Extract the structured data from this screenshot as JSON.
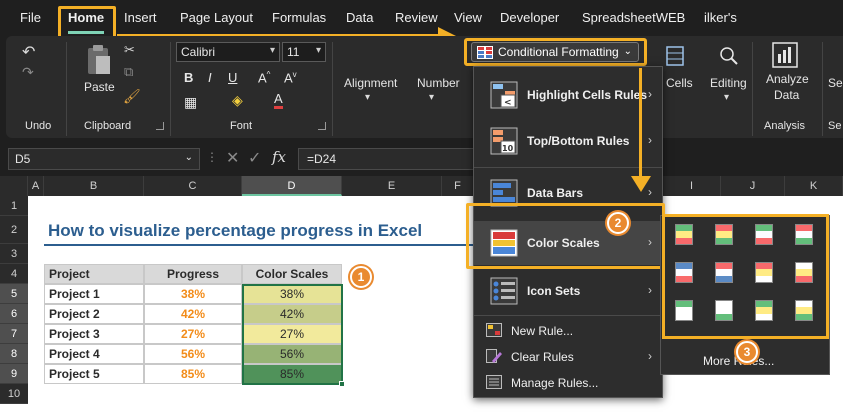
{
  "tabs": [
    "File",
    "Home",
    "Insert",
    "Page Layout",
    "Formulas",
    "Data",
    "Review",
    "View",
    "Developer",
    "SpreadsheetWEB",
    "ilker's"
  ],
  "ribbon": {
    "groups": {
      "undo": "Undo",
      "clipboard": "Clipboard",
      "font": "Font",
      "analysis": "Analysis",
      "sensitivity_partial": "Se"
    },
    "paste_label": "Paste",
    "font_name": "Calibri",
    "font_size": "11",
    "alignment_label": "Alignment",
    "number_label": "Number",
    "cells_label": "Cells",
    "editing_label": "Editing",
    "analyze_line1": "Analyze",
    "analyze_line2": "Data",
    "sens_partial": "Sen",
    "conditional_formatting": "Conditional Formatting"
  },
  "formula_bar": {
    "name_box": "D5",
    "formula": "=D24"
  },
  "columns": [
    "A",
    "B",
    "C",
    "D",
    "E",
    "F",
    "G",
    "H",
    "I",
    "J",
    "K"
  ],
  "rows": [
    "1",
    "2",
    "3",
    "4",
    "5",
    "6",
    "7",
    "8",
    "9",
    "10"
  ],
  "sheet": {
    "title": "How to visualize percentage progress in Excel",
    "headers": [
      "Project",
      "Progress",
      "Color Scales"
    ],
    "projects": [
      {
        "name": "Project 1",
        "progress": "38%",
        "scale": "38%",
        "color": "#e6e396"
      },
      {
        "name": "Project 2",
        "progress": "42%",
        "scale": "42%",
        "color": "#c6cd8a"
      },
      {
        "name": "Project 3",
        "progress": "27%",
        "scale": "27%",
        "color": "#f2ea9c"
      },
      {
        "name": "Project 4",
        "progress": "56%",
        "scale": "56%",
        "color": "#97b375"
      },
      {
        "name": "Project 5",
        "progress": "85%",
        "scale": "85%",
        "color": "#50925a"
      }
    ]
  },
  "menu": {
    "items": [
      {
        "label": "Highlight Cells Rules",
        "icon": "highlight-cells-icon",
        "submenu": true
      },
      {
        "label": "Top/Bottom Rules",
        "icon": "top-bottom-icon",
        "submenu": true
      },
      {
        "label": "Data Bars",
        "icon": "data-bars-icon",
        "submenu": true
      },
      {
        "label": "Color Scales",
        "icon": "color-scales-icon",
        "submenu": true
      },
      {
        "label": "Icon Sets",
        "icon": "icon-sets-icon",
        "submenu": true
      }
    ],
    "small_items": [
      {
        "label": "New Rule...",
        "icon": "new-rule-icon"
      },
      {
        "label": "Clear Rules",
        "icon": "clear-rules-icon",
        "submenu": true
      },
      {
        "label": "Manage Rules...",
        "icon": "manage-rules-icon"
      }
    ]
  },
  "submenu": {
    "more_rules": "More Rules...",
    "scales": [
      [
        "#63be7b",
        "#ffeb84",
        "#f8696b"
      ],
      [
        "#f8696b",
        "#ffeb84",
        "#63be7b"
      ],
      [
        "#63be7b",
        "#fcfcff",
        "#f8696b"
      ],
      [
        "#f8696b",
        "#fcfcff",
        "#63be7b"
      ],
      [
        "#5a8ac6",
        "#fcfcff",
        "#f8696b"
      ],
      [
        "#f8696b",
        "#fcfcff",
        "#5a8ac6"
      ],
      [
        "#f8696b",
        "#ffeb84",
        "#ffffff"
      ],
      [
        "#ffffff",
        "#ffeb84",
        "#f8696b"
      ],
      [
        "#63be7b",
        "#ffffff",
        "#ffffff"
      ],
      [
        "#ffffff",
        "#ffffff",
        "#63be7b"
      ],
      [
        "#63be7b",
        "#ffeb84",
        "#ffffff"
      ],
      [
        "#ffffff",
        "#ffeb84",
        "#63be7b"
      ]
    ]
  },
  "badges": [
    "1",
    "2",
    "3"
  ],
  "colors": {
    "accent": "#f4b026",
    "badge": "#e98a30",
    "progress_text": "#f28c1a",
    "title": "#2c5e8f"
  }
}
